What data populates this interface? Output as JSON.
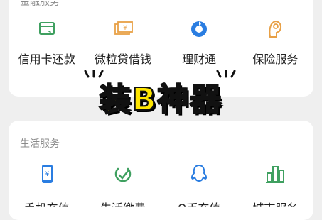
{
  "finance": {
    "title": "金融服务",
    "items": [
      {
        "label": "信用卡还款",
        "icon": "credit-card-repay-icon"
      },
      {
        "label": "微粒贷借钱",
        "icon": "loan-money-icon"
      },
      {
        "label": "理财通",
        "icon": "wealth-icon"
      },
      {
        "label": "保险服务",
        "icon": "insurance-icon"
      }
    ]
  },
  "life": {
    "title": "生活服务",
    "items": [
      {
        "label": "手机充值",
        "icon": "phone-topup-icon"
      },
      {
        "label": "生活缴费",
        "icon": "utility-bill-icon"
      },
      {
        "label": "Q币充值",
        "icon": "qq-coin-icon"
      },
      {
        "label": "城市服务",
        "icon": "city-services-icon"
      }
    ]
  },
  "overlay": {
    "text": "装B神器"
  },
  "colors": {
    "green": "#3fa060",
    "orange": "#e8a046",
    "blue": "#2a7de1",
    "overlay": "#ffe600"
  }
}
